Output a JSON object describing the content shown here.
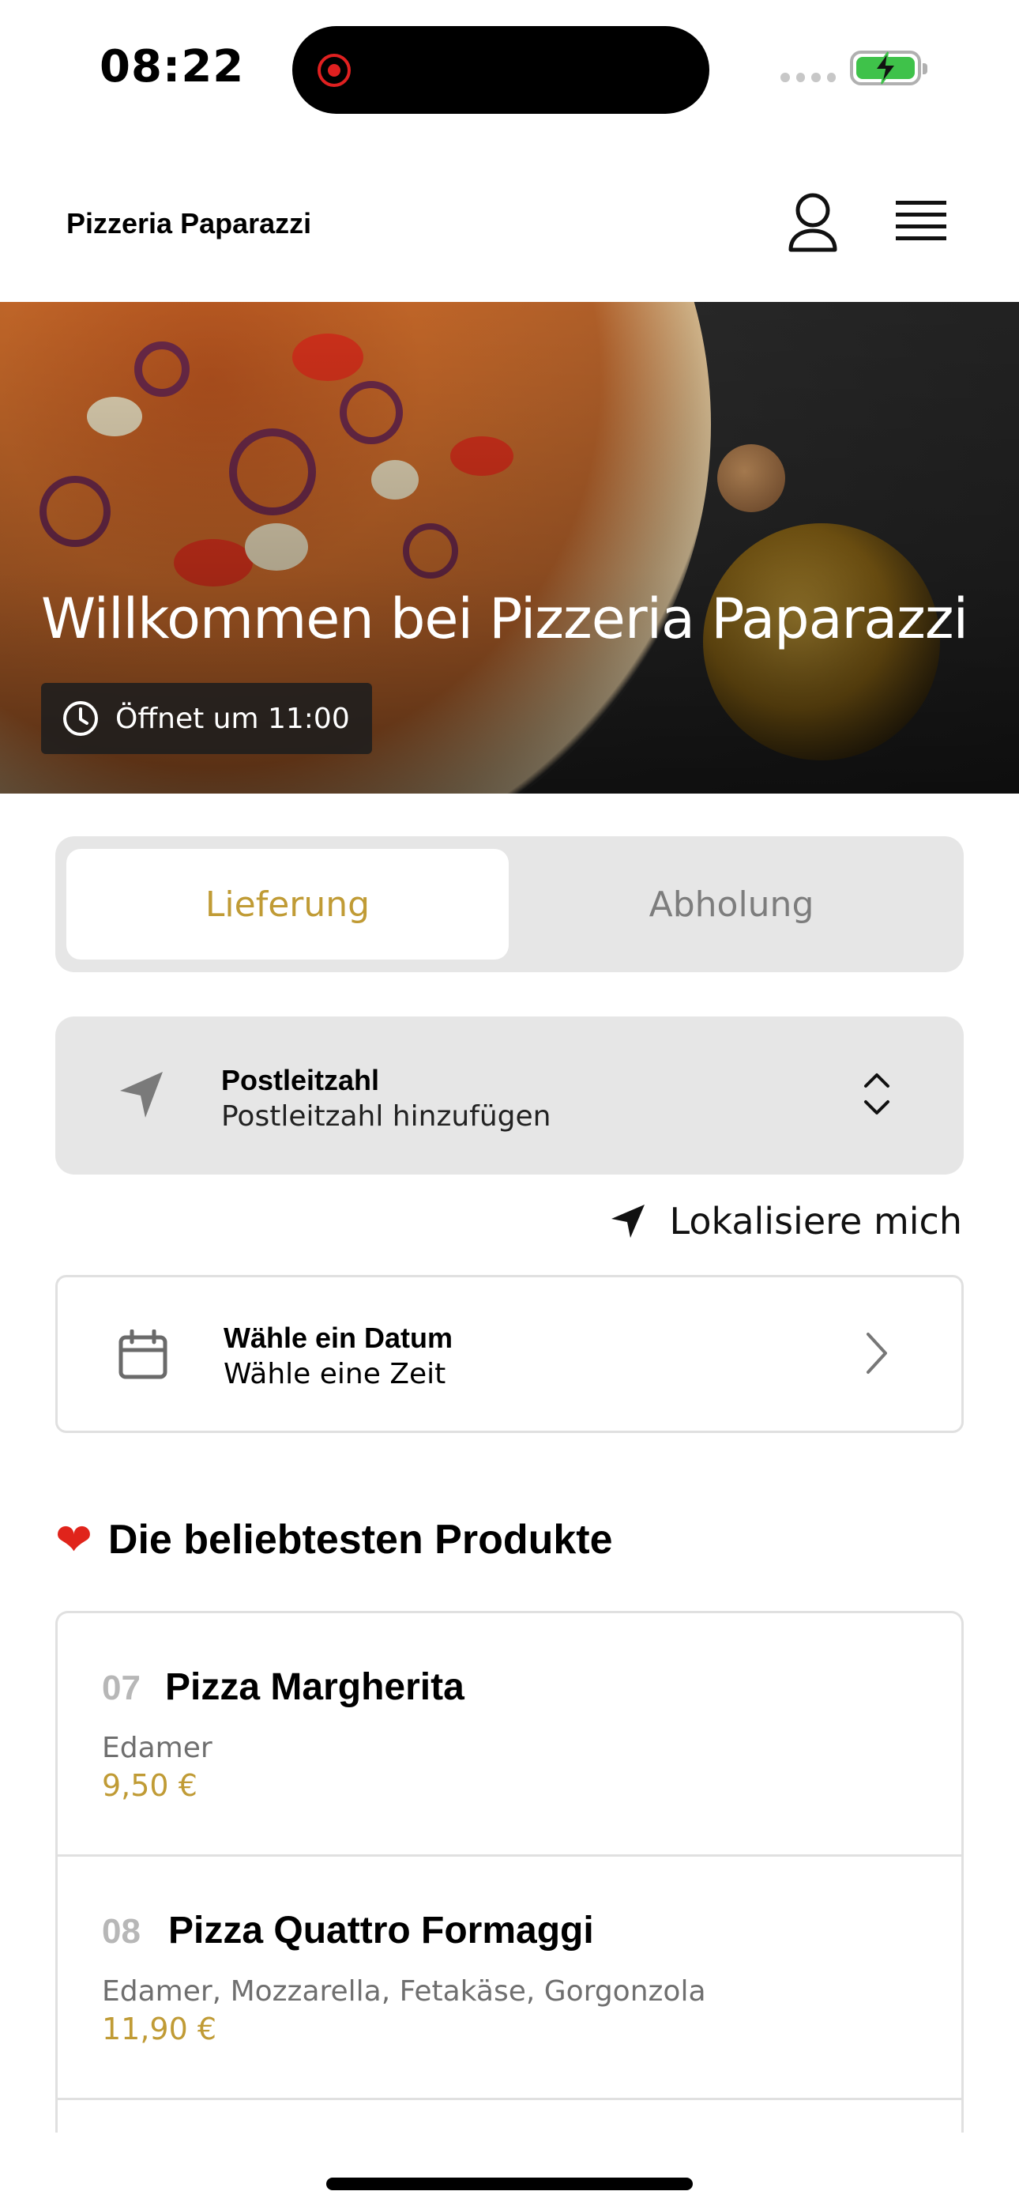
{
  "status_bar": {
    "time": "08:22"
  },
  "header": {
    "brand": "Pizzeria Paparazzi"
  },
  "hero": {
    "title": "Willkommen bei Pizzeria Paparazzi",
    "hours": "Öffnet um 11:00"
  },
  "tabs": [
    {
      "label": "Lieferung",
      "active": true
    },
    {
      "label": "Abholung",
      "active": false
    }
  ],
  "postcode": {
    "label": "Postleitzahl",
    "value": "Postleitzahl hinzufügen"
  },
  "locate": {
    "label": "Lokalisiere mich"
  },
  "date_picker": {
    "label": "Wähle ein Datum",
    "value": "Wähle eine Zeit"
  },
  "popular": {
    "title": "Die beliebtesten Produkte",
    "icon": "heart-icon",
    "products": [
      {
        "number": "07",
        "name": "Pizza Margherita",
        "description": "Edamer",
        "price": "9,50 €"
      },
      {
        "number": "08",
        "name": "Pizza Quattro Formaggi",
        "description": "Edamer, Mozzarella, Fetakäse, Gorgonzola",
        "price": "11,90 €"
      }
    ]
  },
  "colors": {
    "accent": "#c09b35",
    "muted": "#7d7d7d",
    "surface": "#e6e6e6"
  }
}
